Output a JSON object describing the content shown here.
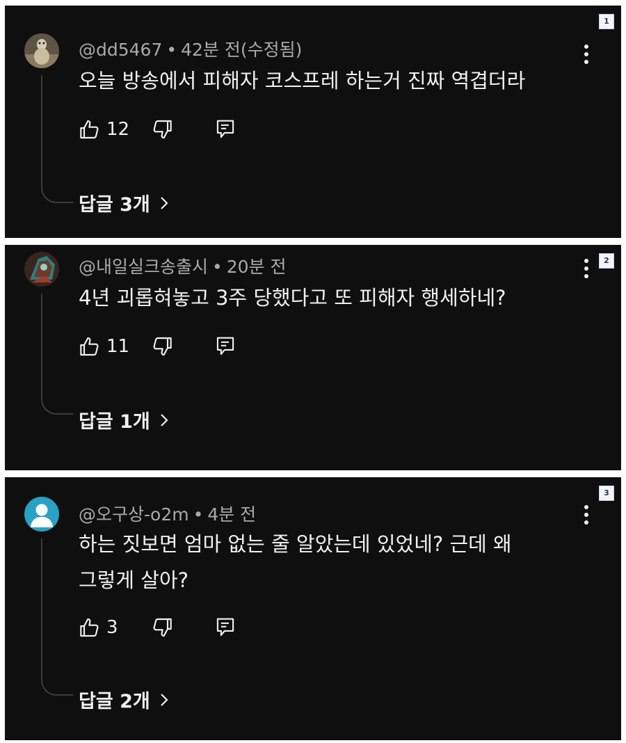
{
  "comments": [
    {
      "badge": "1",
      "author": "@dd5467",
      "time": "42분 전(수정됨)",
      "lines": [
        "오늘 방송에서 피해자 코스프레 하는거 진짜 역겹더라"
      ],
      "likes": "12",
      "replies_label": "답글 3개",
      "avatar": "photo-avatar"
    },
    {
      "badge": "2",
      "author": "@내일실크송출시",
      "time": "20분 전",
      "lines": [
        "4년 괴롭혀놓고 3주 당했다고 또 피해자 행세하네?"
      ],
      "likes": "11",
      "replies_label": "답글 1개",
      "avatar": "game-character-avatar"
    },
    {
      "badge": "3",
      "author": "@오구상-o2m",
      "time": "4분 전",
      "lines": [
        "하는 짓보면 엄마 없는 줄 알았는데 있었네? 근데 왜",
        "그렇게 살아?"
      ],
      "likes": "3",
      "replies_label": "답글 2개",
      "avatar": "default-person-avatar"
    }
  ],
  "separator": "•",
  "colors": {
    "panel_bg": "#0f0f0f",
    "text": "#f1f1f1",
    "meta": "#aaaaaa",
    "default_avatar": "#2aa1c4"
  }
}
